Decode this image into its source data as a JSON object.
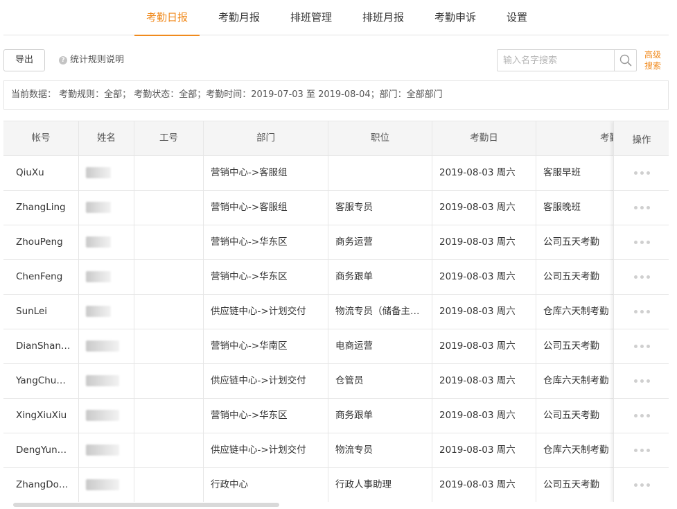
{
  "tabs": [
    {
      "label": "考勤日报",
      "active": true
    },
    {
      "label": "考勤月报",
      "active": false
    },
    {
      "label": "排班管理",
      "active": false
    },
    {
      "label": "排班月报",
      "active": false
    },
    {
      "label": "考勤申诉",
      "active": false
    },
    {
      "label": "设置",
      "active": false
    }
  ],
  "toolbar": {
    "export_label": "导出",
    "rule_link": "统计规则说明",
    "search_placeholder": "输入名字搜索",
    "advanced_search": "高级搜索"
  },
  "summary": "当前数据： 考勤规则：全部； 考勤状态：全部；考勤时间：2019-07-03 至 2019-08-04；部门：全部部门",
  "table": {
    "columns": [
      "帐号",
      "姓名",
      "工号",
      "部门",
      "职位",
      "考勤日",
      "考勤",
      "操作"
    ],
    "rows": [
      {
        "account": "QiuXu",
        "dept": "营销中心->客服组",
        "position": "",
        "date": "2019-08-03 周六",
        "rule": "客服早班"
      },
      {
        "account": "ZhangLing",
        "dept": "营销中心->客服组",
        "position": "客服专员",
        "date": "2019-08-03 周六",
        "rule": "客服晚班"
      },
      {
        "account": "ZhouPeng",
        "dept": "营销中心->华东区",
        "position": "商务运营",
        "date": "2019-08-03 周六",
        "rule": "公司五天考勤"
      },
      {
        "account": "ChenFeng",
        "dept": "营销中心->华东区",
        "position": "商务跟单",
        "date": "2019-08-03 周六",
        "rule": "公司五天考勤"
      },
      {
        "account": "SunLei",
        "dept": "供应链中心->计划交付",
        "position": "物流专员（储备主…",
        "date": "2019-08-03 周六",
        "rule": "仓库六天制考勤"
      },
      {
        "account": "DianShan…",
        "dept": "营销中心->华南区",
        "position": "电商运营",
        "date": "2019-08-03 周六",
        "rule": "公司五天考勤"
      },
      {
        "account": "YangChu…",
        "dept": "供应链中心->计划交付",
        "position": "仓管员",
        "date": "2019-08-03 周六",
        "rule": "仓库六天制考勤"
      },
      {
        "account": "XingXiuXiu",
        "dept": "营销中心->华东区",
        "position": "商务跟单",
        "date": "2019-08-03 周六",
        "rule": "公司五天考勤"
      },
      {
        "account": "DengYun…",
        "dept": "供应链中心->计划交付",
        "position": "物流专员",
        "date": "2019-08-03 周六",
        "rule": "仓库六天制考勤"
      },
      {
        "account": "ZhangDo…",
        "dept": "行政中心",
        "position": "行政人事助理",
        "date": "2019-08-03 周六",
        "rule": "公司五天考勤"
      }
    ]
  },
  "colors": {
    "accent": "#f08a1d",
    "border": "#e6e6e6",
    "header_bg": "#f5f5f5"
  },
  "icons": {
    "help": "question-circle-icon",
    "search": "search-icon",
    "more": "more-dots-icon"
  }
}
